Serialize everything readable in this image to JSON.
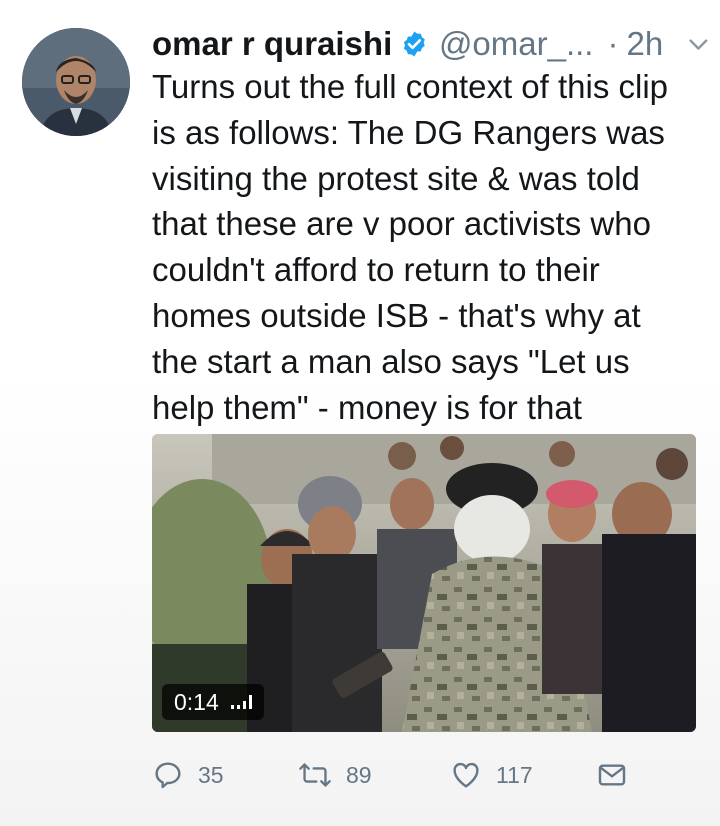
{
  "tweet": {
    "display_name": "omar r quraishi",
    "handle": "@omar_...",
    "separator": "·",
    "timestamp": "2h",
    "text_lines": [
      "Turns out the full context of this clip",
      "is as follows: The DG Rangers was",
      "visiting the protest site & was told",
      "that these are v poor activists who",
      "couldn't afford to return to their",
      "homes outside ISB - that's why at",
      "the start a man also says \"Let us",
      "help them\" - money is for that"
    ],
    "media": {
      "duration": "0:14"
    }
  },
  "actions": {
    "replies": "35",
    "retweets": "89",
    "likes": "117"
  },
  "colors": {
    "verified_badge": "#1da1f2",
    "secondary_text": "#657786",
    "primary_text": "#14171a"
  },
  "icons": [
    "verified-icon",
    "chevron-down-icon",
    "reply-icon",
    "retweet-icon",
    "like-icon",
    "direct-message-icon",
    "volume-icon"
  ]
}
